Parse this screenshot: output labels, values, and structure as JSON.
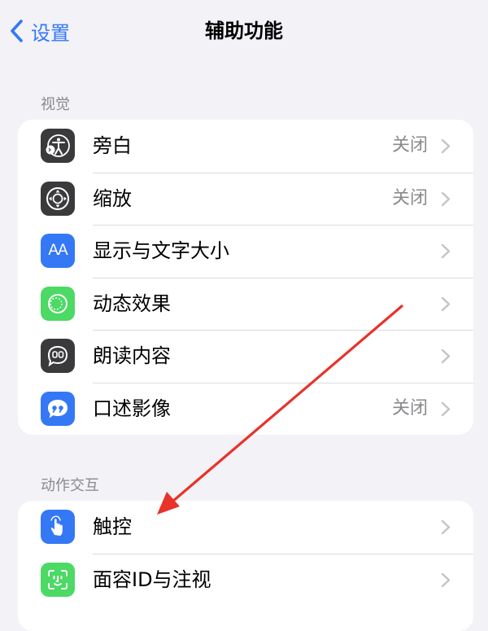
{
  "nav": {
    "back_label": "设置",
    "title": "辅助功能"
  },
  "sections": [
    {
      "header": "视觉",
      "items": [
        {
          "label": "旁白",
          "value": "关闭",
          "icon": "voiceover-icon",
          "icon_color": "#3a3a3c"
        },
        {
          "label": "缩放",
          "value": "关闭",
          "icon": "zoom-icon",
          "icon_color": "#3a3a3c"
        },
        {
          "label": "显示与文字大小",
          "value": "",
          "icon": "text-size-icon",
          "icon_color": "#3478f6",
          "icon_text": "AA"
        },
        {
          "label": "动态效果",
          "value": "",
          "icon": "motion-icon",
          "icon_color": "#4cd964"
        },
        {
          "label": "朗读内容",
          "value": "",
          "icon": "spoken-content-icon",
          "icon_color": "#3a3a3c"
        },
        {
          "label": "口述影像",
          "value": "关闭",
          "icon": "audio-description-icon",
          "icon_color": "#3478f6"
        }
      ]
    },
    {
      "header": "动作交互",
      "items": [
        {
          "label": "触控",
          "value": "",
          "icon": "touch-icon",
          "icon_color": "#3478f6"
        },
        {
          "label": "面容ID与注视",
          "value": "",
          "icon": "face-id-icon",
          "icon_color": "#4cd964"
        }
      ]
    }
  ],
  "annotation": {
    "color": "#e8322a"
  }
}
